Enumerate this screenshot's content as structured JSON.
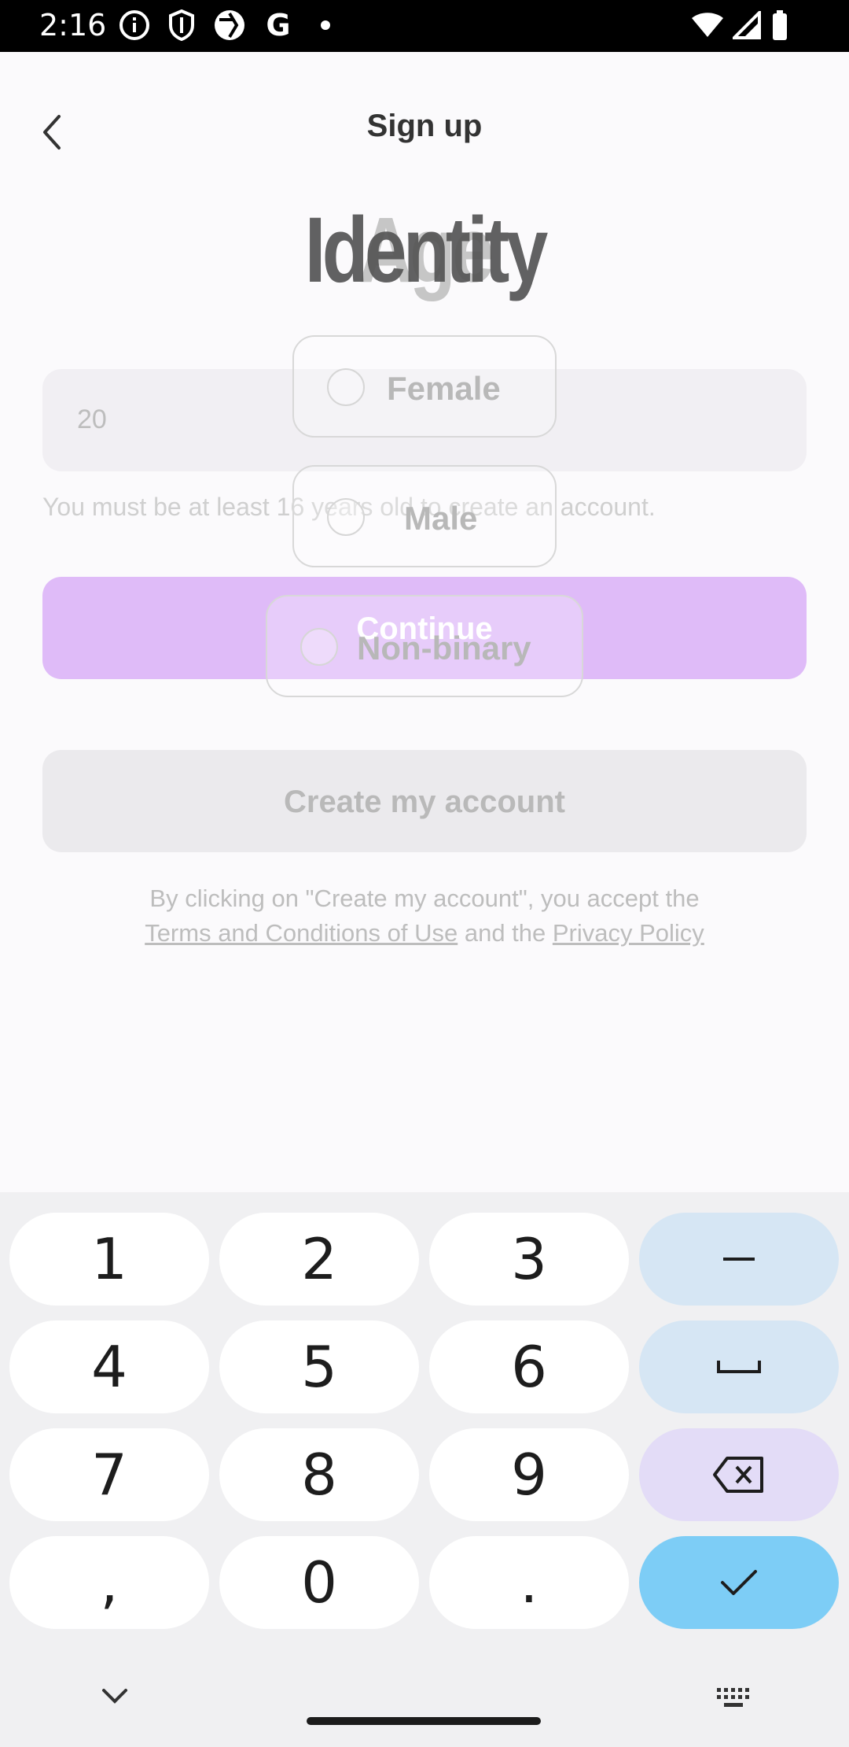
{
  "status_bar": {
    "time": "2:16",
    "left_icons": [
      "info-icon",
      "shield-icon",
      "aperture-icon",
      "google-g-icon",
      "dot-icon"
    ],
    "google_letter": "G",
    "right_icons": [
      "wifi-icon",
      "signal-icon",
      "battery-icon"
    ]
  },
  "header": {
    "title": "Sign up",
    "back_icon": "chevron-left-icon"
  },
  "age_screen": {
    "heading": "Age",
    "input_value": "20",
    "hint": "You must be at least 16 years old to create an account.",
    "continue_label": "Continue"
  },
  "identity_screen": {
    "heading": "Identity",
    "options": [
      {
        "label": "Female"
      },
      {
        "label": "Male"
      },
      {
        "label": "Non-binary"
      }
    ]
  },
  "create_account": {
    "label": "Create my account"
  },
  "legal": {
    "line1": "By clicking on \"Create my account\", you accept the",
    "terms_link": "Terms and Conditions of Use",
    "and_text": " and the ",
    "privacy_link": "Privacy Policy"
  },
  "keyboard": {
    "keys": [
      "1",
      "2",
      "3",
      "–",
      "4",
      "5",
      "6",
      "␣",
      "7",
      "8",
      "9",
      "⌫",
      ",",
      "0",
      ".",
      "✓"
    ],
    "key_colors": {
      "digit": "#ffffff",
      "func": "#d6e6f4",
      "delete": "#e3dcf7",
      "done": "#7dcdf6"
    }
  },
  "colors": {
    "continue_bg": "#dfbbf8",
    "create_bg": "#ebeaed",
    "app_bg": "#fbfafc"
  }
}
